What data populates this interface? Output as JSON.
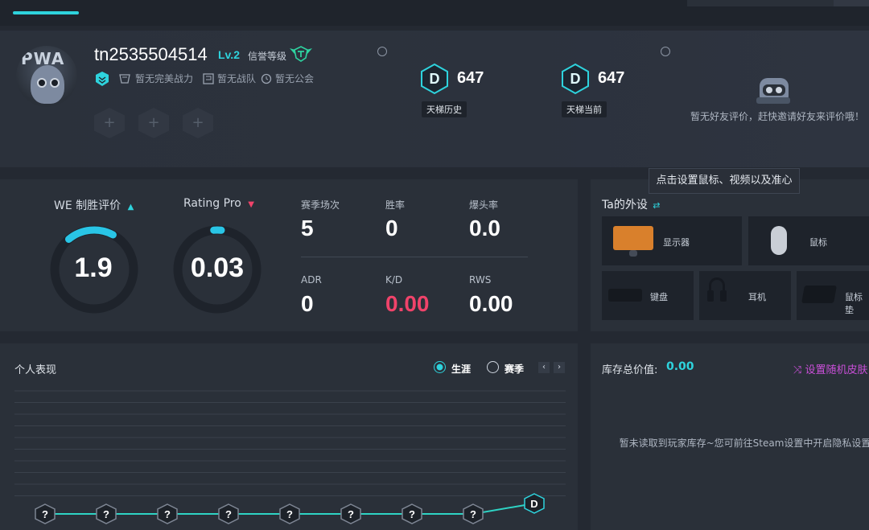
{
  "profile": {
    "username": "tn2535504514",
    "level": "Lv.2",
    "credit_label": "信誉等级",
    "badges": [
      {
        "icon": "tablet-icon",
        "label": "暂无完美战力"
      },
      {
        "icon": "flag-icon",
        "label": "暂无战队"
      },
      {
        "icon": "clock-icon",
        "label": "暂无公会"
      }
    ],
    "slot_symbol": "+"
  },
  "ladder": [
    {
      "letter": "D",
      "value": "647",
      "label": "天梯历史"
    },
    {
      "letter": "D",
      "value": "647",
      "label": "天梯当前"
    }
  ],
  "friend": {
    "text": "暂无好友评价，赶快邀请好友来评价哦！"
  },
  "tooltip": "点击设置鼠标、视频以及准心",
  "stats": {
    "we_label": "WE 制胜评价",
    "we_value": "1.9",
    "we_progress": 0.19,
    "rating_label": "Rating Pro",
    "rating_value": "0.03",
    "rating_progress": 0.03,
    "grid": [
      {
        "label": "赛季场次",
        "value": "5",
        "color": "white"
      },
      {
        "label": "胜率",
        "value": "0",
        "color": "white"
      },
      {
        "label": "爆头率",
        "value": "0.0",
        "color": "white"
      },
      {
        "label": "ADR",
        "value": "0",
        "color": "white"
      },
      {
        "label": "K/D",
        "value": "0.00",
        "color": "red"
      },
      {
        "label": "RWS",
        "value": "0.00",
        "color": "white"
      }
    ]
  },
  "gear": {
    "title": "Ta的外设",
    "items": [
      {
        "label": "显示器"
      },
      {
        "label": "鼠标"
      },
      {
        "label": "键盘"
      },
      {
        "label": "耳机"
      },
      {
        "label": "鼠标垫"
      }
    ]
  },
  "performance": {
    "title": "个人表现",
    "radio_career": "生涯",
    "radio_season": "赛季",
    "pager_prev": "‹",
    "pager_next": "›",
    "markers": [
      "?",
      "?",
      "?",
      "?",
      "?",
      "?",
      "?",
      "?",
      "D"
    ]
  },
  "inventory": {
    "label": "库存总价值:",
    "value": "0.00",
    "action": "设置随机皮肤",
    "empty_text": "暂未读取到玩家库存~您可前往Steam设置中开启隐私设置"
  },
  "colors": {
    "accent": "#2ed3dd",
    "red": "#f0436a",
    "purple": "#c94fd8"
  }
}
